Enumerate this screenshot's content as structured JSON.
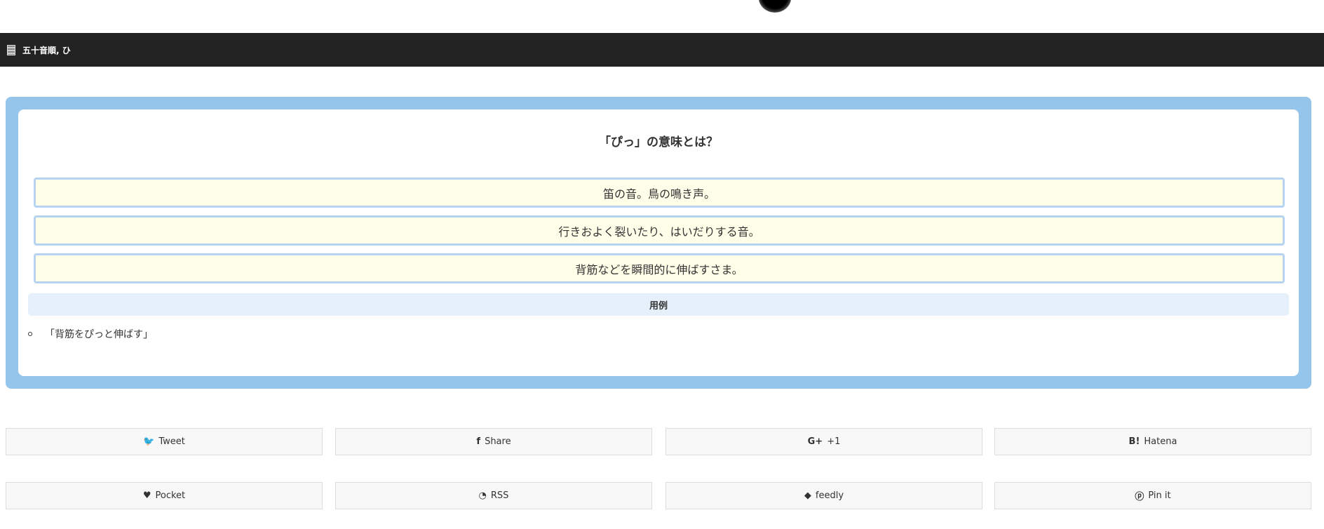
{
  "header": {
    "breadcrumb": "五十音順, ひ"
  },
  "quiz": {
    "title": "「ぴっ」の意味とは？",
    "options": [
      "笛の音。鳥の鳴き声。",
      "行きおよく裂いたり、はいだりする音。",
      "背筋などを瞬間的に伸ばすさま。"
    ]
  },
  "examples": {
    "heading": "用例",
    "items": [
      "「背筋をぴっと伸ばす」"
    ]
  },
  "share": [
    {
      "label": "Tweet",
      "icon": "twitter-icon",
      "glyph": "🐦"
    },
    {
      "label": "Share",
      "icon": "facebook-icon",
      "glyph": "f"
    },
    {
      "label": "+1",
      "icon": "google-plus-icon",
      "glyph": "G+"
    },
    {
      "label": "Hatena",
      "icon": "hatena-icon",
      "glyph": "B!"
    },
    {
      "label": "Pocket",
      "icon": "pocket-icon",
      "glyph": "♥"
    },
    {
      "label": "RSS",
      "icon": "rss-icon",
      "glyph": "◔"
    },
    {
      "label": "feedly",
      "icon": "feedly-icon",
      "glyph": "◆"
    },
    {
      "label": "Pin it",
      "icon": "pinterest-icon",
      "glyph": "ⓟ"
    }
  ]
}
